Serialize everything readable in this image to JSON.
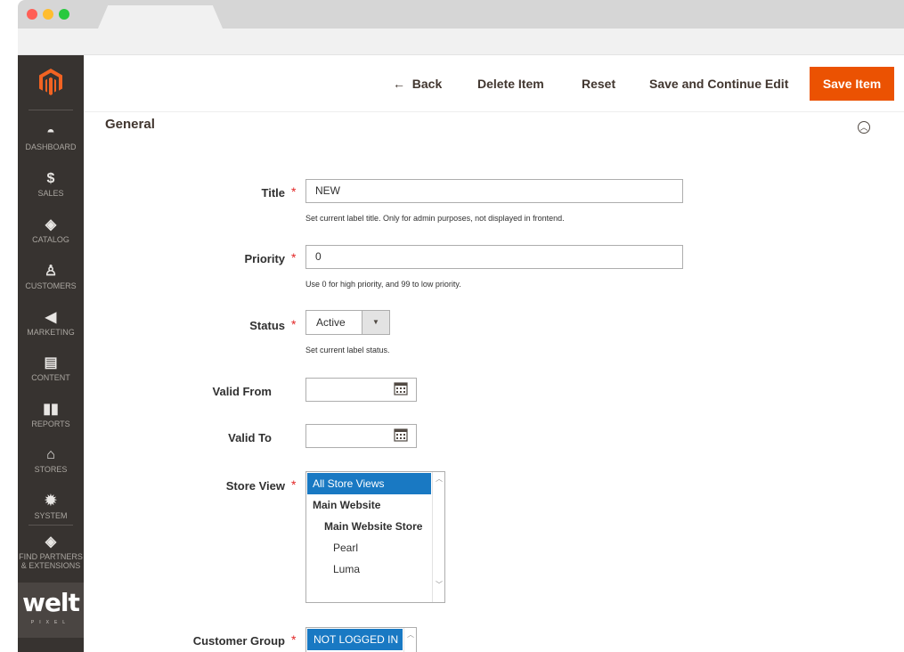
{
  "window": {
    "dot_colors": [
      "#ff5f56",
      "#ffbd2e",
      "#27c93f"
    ]
  },
  "sidebar": {
    "items": [
      {
        "label": "DASHBOARD",
        "icon": "dashboard-icon"
      },
      {
        "label": "SALES",
        "icon": "dollar-icon"
      },
      {
        "label": "CATALOG",
        "icon": "box-icon"
      },
      {
        "label": "CUSTOMERS",
        "icon": "person-icon"
      },
      {
        "label": "MARKETING",
        "icon": "megaphone-icon"
      },
      {
        "label": "CONTENT",
        "icon": "layout-icon"
      },
      {
        "label": "REPORTS",
        "icon": "bar-chart-icon"
      },
      {
        "label": "STORES",
        "icon": "store-icon"
      },
      {
        "label": "SYSTEM",
        "icon": "gear-icon"
      }
    ],
    "partners": {
      "line1": "FIND PARTNERS",
      "line2": "& EXTENSIONS"
    },
    "brand": {
      "name": "welt",
      "sub": "PIXEL"
    }
  },
  "toolbar": {
    "back_label": "Back",
    "back_arrow": "←",
    "delete_label": "Delete Item",
    "reset_label": "Reset",
    "save_continue_label": "Save and Continue Edit",
    "save_label": "Save Item",
    "accent_color": "#eb5202"
  },
  "section": {
    "title": "General"
  },
  "form": {
    "title": {
      "label": "Title",
      "value": "NEW",
      "note": "Set current label title. Only for admin purposes, not displayed in frontend."
    },
    "priority": {
      "label": "Priority",
      "value": "0",
      "note": "Use 0 for high priority, and 99 to low priority."
    },
    "status": {
      "label": "Status",
      "value": "Active",
      "note": "Set current label status."
    },
    "valid_from": {
      "label": "Valid From",
      "value": ""
    },
    "valid_to": {
      "label": "Valid To",
      "value": ""
    },
    "store_view": {
      "label": "Store View",
      "options": [
        {
          "text": "All Store Views",
          "selected": true,
          "indent": 0,
          "bold": false
        },
        {
          "text": "Main Website",
          "selected": false,
          "indent": 0,
          "bold": true
        },
        {
          "text": "Main Website Store",
          "selected": false,
          "indent": 1,
          "bold": true
        },
        {
          "text": "Pearl",
          "selected": false,
          "indent": 2,
          "bold": false
        },
        {
          "text": "Luma",
          "selected": false,
          "indent": 2,
          "bold": false
        }
      ]
    },
    "customer_group": {
      "label": "Customer Group",
      "options": [
        {
          "text": "NOT LOGGED IN",
          "selected": true
        }
      ]
    },
    "required_mark": "*"
  }
}
